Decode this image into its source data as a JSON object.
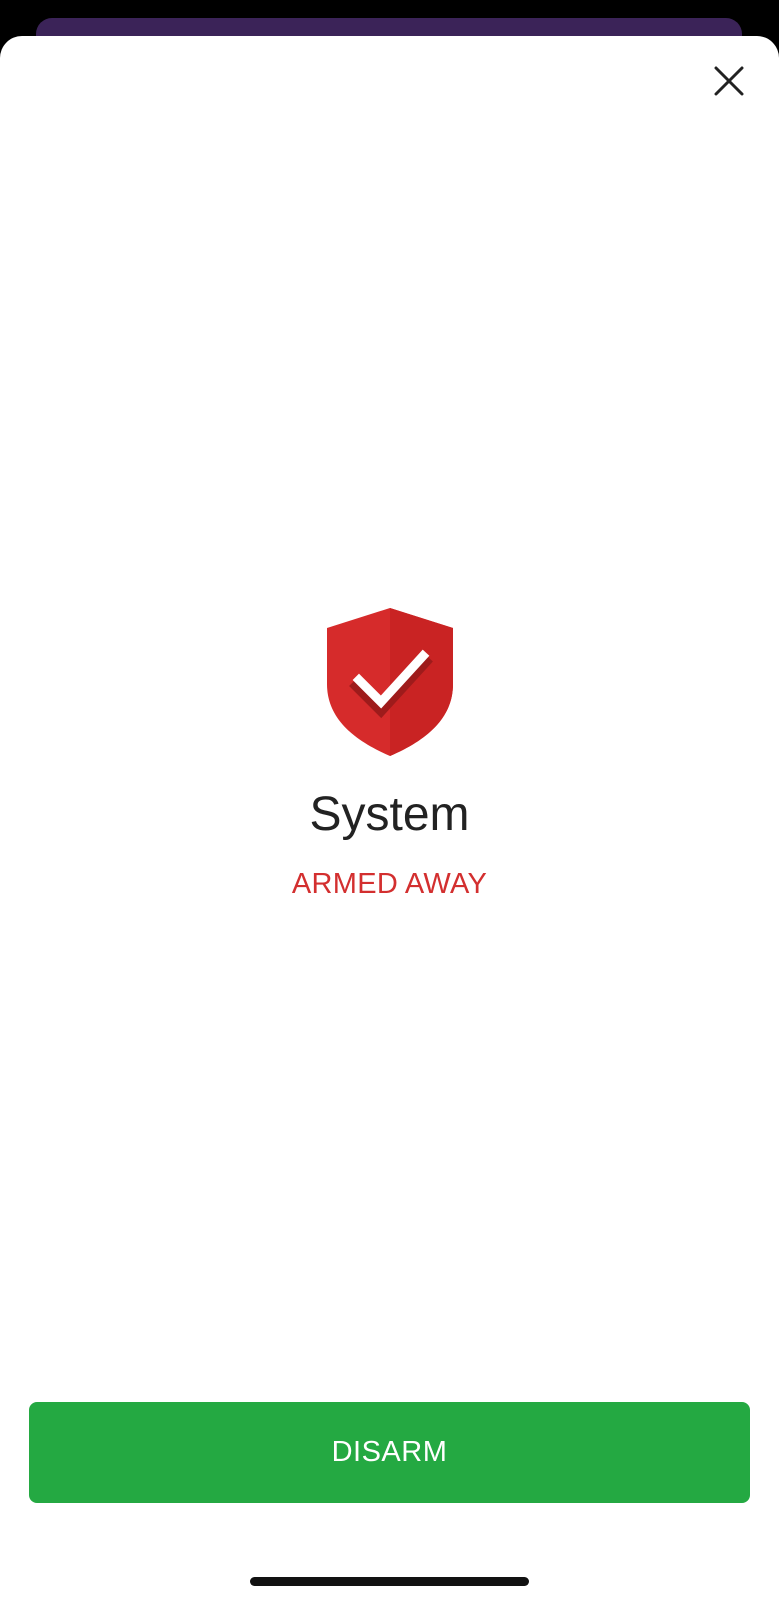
{
  "dialog": {
    "close_icon": "close-icon",
    "shield_icon": "shield-check-icon",
    "title": "System",
    "status": "ARMED AWAY",
    "status_color": "#d32f2f",
    "primary_button_label": "DISARM",
    "primary_button_color": "#24a942"
  }
}
